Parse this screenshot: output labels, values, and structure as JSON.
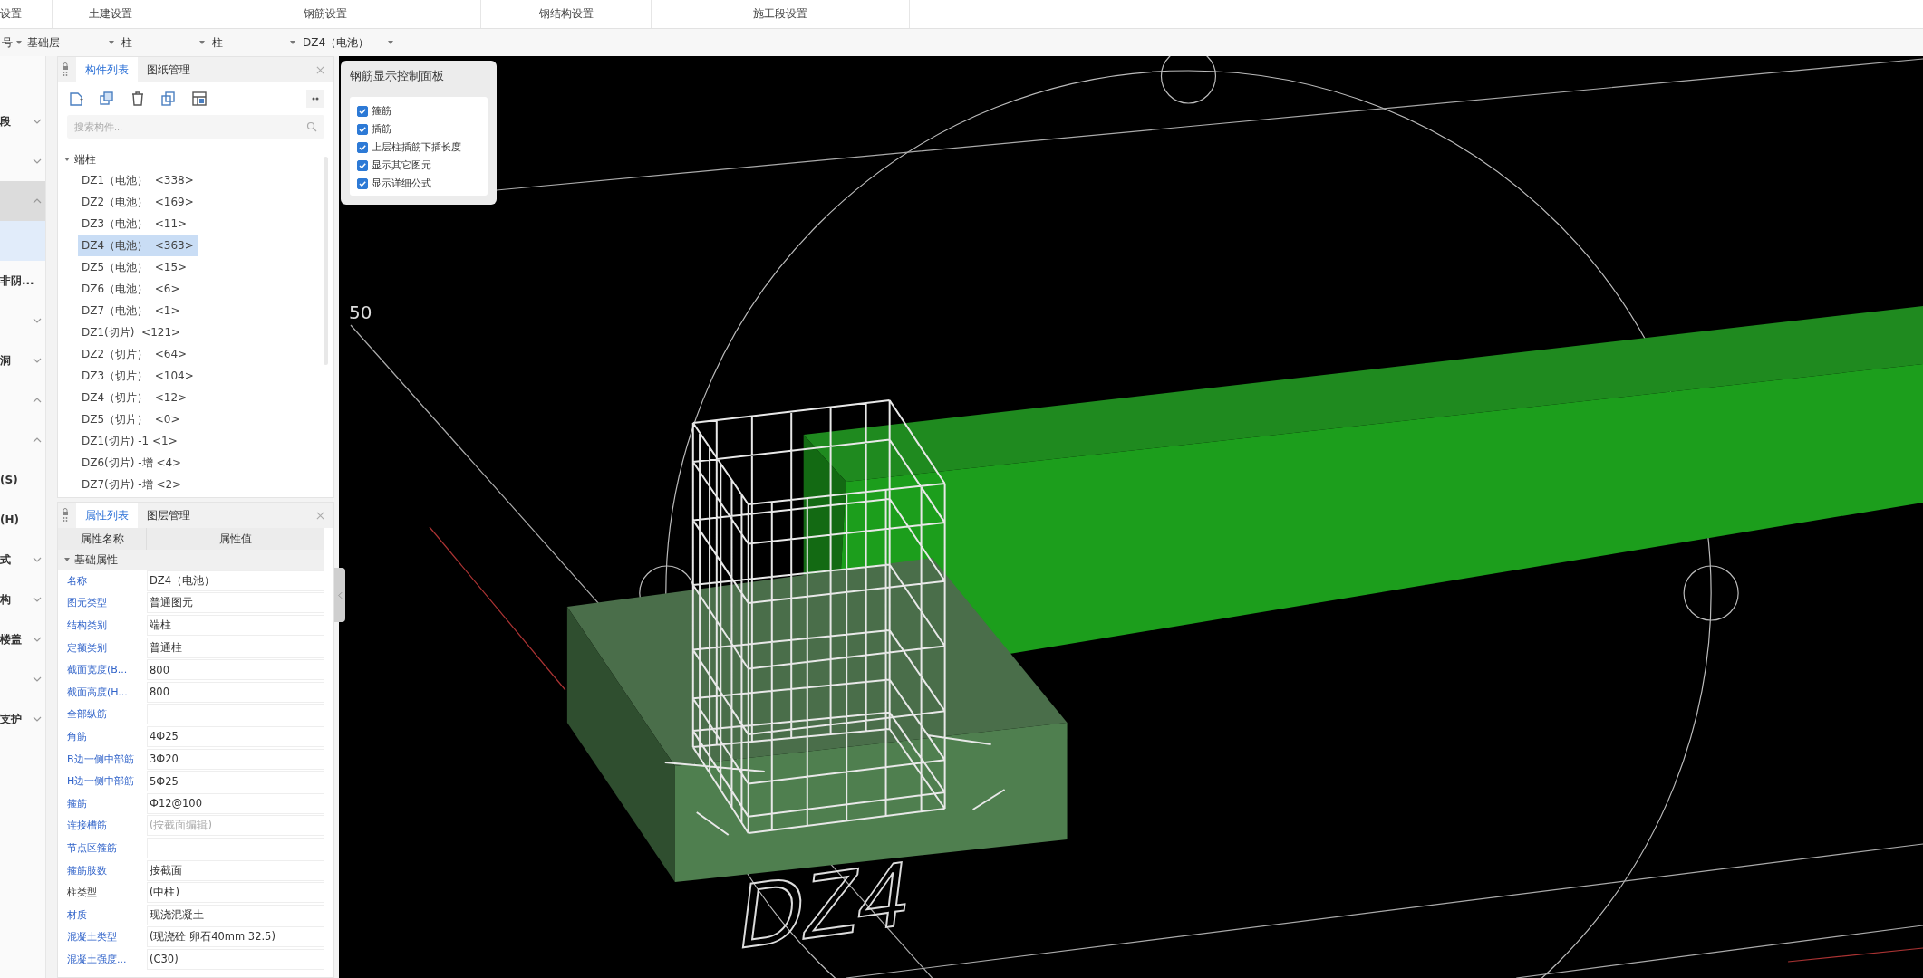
{
  "top_tabs": [
    {
      "label": "设置",
      "selected": false
    },
    {
      "label": "土建设置",
      "selected": false
    },
    {
      "label": "钢筋设置",
      "selected": false
    },
    {
      "label": "钢结构设置",
      "selected": false
    },
    {
      "label": "施工段设置",
      "selected": false
    }
  ],
  "toolbar": {
    "dropdowns": [
      "号",
      "基础层",
      "柱",
      "柱",
      "DZ4（电池）"
    ]
  },
  "side_strip": {
    "items": [
      {
        "kind": "item",
        "label": "段",
        "expanded": false,
        "selected": false
      },
      {
        "kind": "item",
        "expanded": false,
        "selected": false
      },
      {
        "kind": "group",
        "expanded": true,
        "selected": false
      },
      {
        "kind": "item",
        "selected": true
      },
      {
        "kind": "item",
        "label": "非阴...",
        "selected": false
      },
      {
        "kind": "item",
        "expanded": false,
        "selected": false
      },
      {
        "kind": "item",
        "label": "洞",
        "expanded": false,
        "selected": false
      },
      {
        "kind": "item",
        "expanded": true,
        "selected": false
      },
      {
        "kind": "item",
        "expanded": true,
        "selected": false
      },
      {
        "kind": "item",
        "label": "(S)",
        "selected": false
      },
      {
        "kind": "item",
        "label": "(H)",
        "selected": false
      },
      {
        "kind": "item",
        "label": "式",
        "expanded": false,
        "selected": false
      },
      {
        "kind": "item",
        "label": "构",
        "expanded": false,
        "selected": false
      },
      {
        "kind": "item",
        "label": "楼盖",
        "expanded": false,
        "selected": false
      },
      {
        "kind": "item",
        "expanded": false,
        "selected": false
      },
      {
        "kind": "item",
        "label": "支护",
        "expanded": false,
        "selected": false
      }
    ]
  },
  "component_panel": {
    "tabs": [
      {
        "label": "构件列表",
        "selected": true
      },
      {
        "label": "图纸管理",
        "selected": false
      }
    ],
    "search": {
      "placeholder": "搜索构件..."
    },
    "tree": [
      {
        "label": "端柱",
        "expanded": true,
        "children": [
          {
            "label": "DZ1（电池）  <338>",
            "selected": false
          },
          {
            "label": "DZ2（电池）  <169>",
            "selected": false
          },
          {
            "label": "DZ3（电池）  <11>",
            "selected": false
          },
          {
            "label": "DZ4（电池）  <363>",
            "selected": true
          },
          {
            "label": "DZ5（电池）  <15>",
            "selected": false
          },
          {
            "label": "DZ6（电池）  <6>",
            "selected": false
          },
          {
            "label": "DZ7（电池）  <1>",
            "selected": false
          },
          {
            "label": "DZ1(切片)  <121>",
            "selected": false
          },
          {
            "label": "DZ2（切片）  <64>",
            "selected": false
          },
          {
            "label": "DZ3（切片）  <104>",
            "selected": false
          },
          {
            "label": "DZ4（切片）  <12>",
            "selected": false
          },
          {
            "label": "DZ5（切片）  <0>",
            "selected": false
          },
          {
            "label": "DZ1(切片) -1 <1>",
            "selected": false
          },
          {
            "label": "DZ6(切片) -增 <4>",
            "selected": false
          },
          {
            "label": "DZ7(切片) -增 <2>",
            "selected": false
          }
        ]
      }
    ]
  },
  "property_panel": {
    "tabs": [
      {
        "label": "属性列表",
        "selected": true
      },
      {
        "label": "图层管理",
        "selected": false
      }
    ],
    "columns": [
      "属性名称",
      "属性值"
    ],
    "group": {
      "label": "基础属性",
      "expanded": true
    },
    "rows": [
      {
        "name": "名称",
        "value": "DZ4（电池）",
        "public": true,
        "disabled": false
      },
      {
        "name": "图元类型",
        "value": "普通图元",
        "public": true,
        "disabled": false
      },
      {
        "name": "结构类别",
        "value": "端柱",
        "public": true,
        "disabled": false
      },
      {
        "name": "定额类别",
        "value": "普通柱",
        "public": true,
        "disabled": false
      },
      {
        "name": "截面宽度(B...",
        "value": "800",
        "public": true,
        "disabled": false
      },
      {
        "name": "截面高度(H...",
        "value": "800",
        "public": true,
        "disabled": false
      },
      {
        "name": "全部纵筋",
        "public": true,
        "disabled": false
      },
      {
        "name": "角筋",
        "value": "4Ф25",
        "public": true,
        "disabled": false
      },
      {
        "name": "B边一侧中部筋",
        "value": "3Ф20",
        "public": true,
        "disabled": false
      },
      {
        "name": "H边一侧中部筋",
        "value": "5Ф25",
        "public": true,
        "disabled": false
      },
      {
        "name": "箍筋",
        "value": "Ф12@100",
        "public": true,
        "disabled": false
      },
      {
        "name": "连接槽筋",
        "value": "(按截面编辑)",
        "public": true,
        "disabled": true
      },
      {
        "name": "节点区箍筋",
        "public": true,
        "disabled": false
      },
      {
        "name": "箍筋肢数",
        "value": "按截面",
        "public": true,
        "disabled": false
      },
      {
        "name": "柱类型",
        "value": "(中柱)",
        "public": false,
        "disabled": false
      },
      {
        "name": "材质",
        "value": "现浇混凝土",
        "public": true,
        "disabled": false
      },
      {
        "name": "混凝土类型",
        "value": "(现浇砼 卵石40mm 32.5)",
        "public": true,
        "disabled": false
      },
      {
        "name": "混凝土强度...",
        "value": "(C30)",
        "public": true,
        "disabled": false
      }
    ]
  },
  "viewport": {
    "axis_label": "50",
    "element_label": "DZ4",
    "control_panel": {
      "title": "钢筋显示控制面板",
      "options": [
        {
          "label": "箍筋",
          "checked": true
        },
        {
          "label": "插筋",
          "checked": true
        },
        {
          "label": "上层柱插筋下插长度",
          "checked": true
        },
        {
          "label": "显示其它图元",
          "checked": true
        },
        {
          "label": "显示详细公式",
          "checked": true
        }
      ]
    }
  }
}
